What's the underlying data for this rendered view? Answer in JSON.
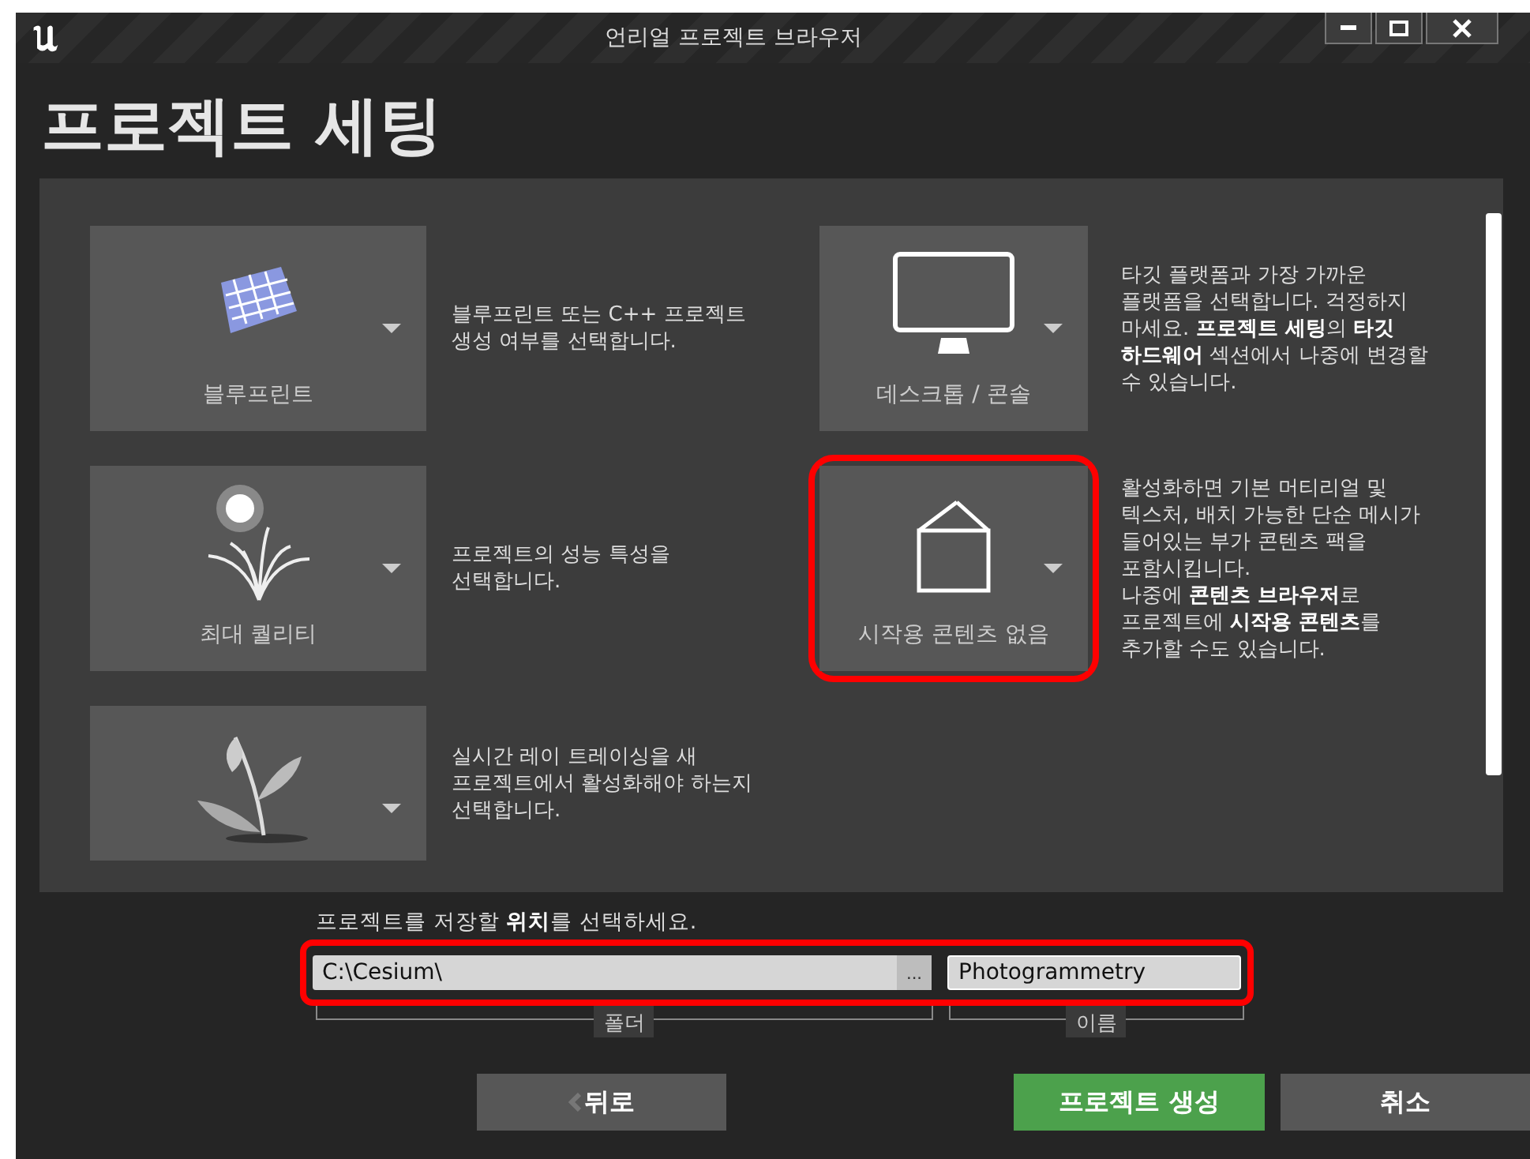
{
  "window": {
    "title": "언리얼 프로젝트 브라우저"
  },
  "heading": "프로젝트 세팅",
  "options": [
    {
      "kind": "blueprint",
      "label": "블루프린트",
      "description": "블루프린트 또는 C++ 프로젝트 생성 여부를 선택합니다.",
      "highlighted": false
    },
    {
      "kind": "monitor",
      "label": "데스크톱 / 콘솔",
      "description": "타깃 플랫폼과 가장 가까운 플랫폼을 선택합니다. 걱정하지 마세요. **프로젝트 세팅**의 **타깃 하드웨어** 섹션에서 나중에 변경할 수 있습니다.",
      "highlighted": false
    },
    {
      "kind": "quality",
      "label": "최대 퀄리티",
      "description": "프로젝트의 성능 특성을 선택합니다.",
      "highlighted": false
    },
    {
      "kind": "box",
      "label": "시작용 콘텐츠 없음",
      "description": "활성화하면 기본 머티리얼 및 텍스처, 배치 가능한 단순 메시가 들어있는 부가 콘텐츠 팩을 포함시킵니다.\n나중에 **콘텐츠 브라우저**로 프로젝트에 **시작용 콘텐츠**를 추가할 수도 있습니다.",
      "highlighted": true
    },
    {
      "kind": "plant",
      "description": "실시간 레이 트레이싱을 새 프로젝트에서 활성화해야 하는지 선택합니다.",
      "highlighted": false
    }
  ],
  "location": {
    "prompt": "프로젝트를 저장할 **위치**를 선택하세요.",
    "folder": "C:\\Cesium\\",
    "browse": "...",
    "name": "Photogrammetry",
    "folder_label": "폴더",
    "name_label": "이름",
    "highlighted": true
  },
  "buttons": [
    {
      "kind": "back",
      "label": "뒤로"
    },
    {
      "kind": "primary",
      "label": "프로젝트 생성"
    },
    {
      "kind": "normal",
      "label": "취소"
    }
  ]
}
